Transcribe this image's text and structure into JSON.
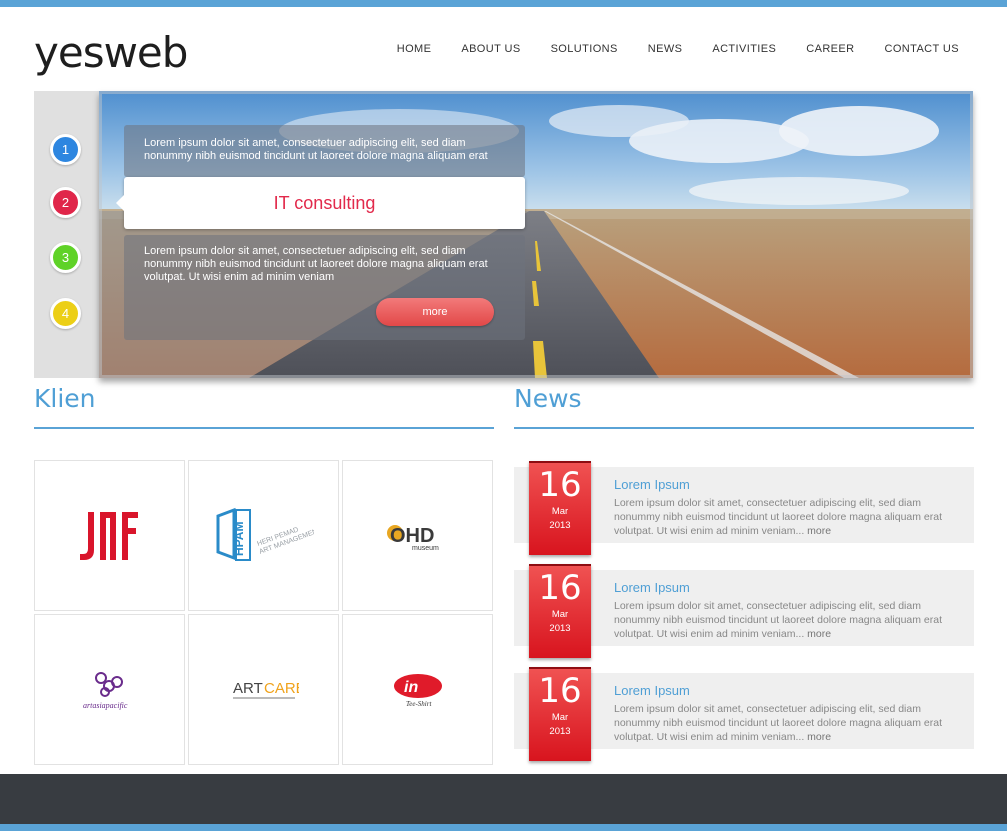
{
  "site": {
    "logo": "yesweb"
  },
  "nav": [
    "HOME",
    "ABOUT US",
    "SOLUTIONS",
    "NEWS",
    "ACTIVITIES",
    "CAREER",
    "CONTACT US"
  ],
  "slider": {
    "dots": [
      {
        "label": "1",
        "color": "#2d86e0"
      },
      {
        "label": "2",
        "color": "#e0264a"
      },
      {
        "label": "3",
        "color": "#5fd227"
      },
      {
        "label": "4",
        "color": "#eccf16"
      }
    ],
    "top_text": "Lorem ipsum dolor sit amet, consectetuer adipiscing elit, sed diam nonummy nibh euismod tincidunt ut laoreet dolore magna aliquam erat",
    "active_title": "IT consulting",
    "body_text": "Lorem ipsum dolor sit amet, consectetuer adipiscing elit, sed diam nonummy nibh euismod tincidunt ut laoreet dolore magna aliquam  erat volutpat. Ut wisi enim ad minim veniam",
    "more_label": "more"
  },
  "klien": {
    "title": "Klien",
    "logos": [
      {
        "name": "jaf-logo",
        "text": "JAF"
      },
      {
        "name": "hpam-logo",
        "text": "HPAM",
        "subtext": "HERI PEMAD ART MANAGEMENT"
      },
      {
        "name": "ohd-museum-logo",
        "text": "OHD",
        "subtext": "museum"
      },
      {
        "name": "artasiapacific-logo",
        "text": "artasiapacific"
      },
      {
        "name": "artcare-logo",
        "text": "ARTCARE"
      },
      {
        "name": "in-tshirt-logo",
        "text": "in",
        "subtext": "Tee-Shirt"
      }
    ]
  },
  "news": {
    "title": "News",
    "items": [
      {
        "day": "16",
        "month": "Mar",
        "year": "2013",
        "title": "Lorem Ipsum",
        "text": "Lorem ipsum dolor sit amet, consectetuer adipiscing elit, sed diam nonummy nibh euismod tincidunt ut laoreet dolore magna aliquam erat volutpat. Ut wisi enim ad minim veniam...",
        "more": "more"
      },
      {
        "day": "16",
        "month": "Mar",
        "year": "2013",
        "title": "Lorem Ipsum",
        "text": "Lorem ipsum dolor sit amet, consectetuer adipiscing elit, sed diam nonummy nibh euismod tincidunt ut laoreet dolore magna aliquam erat volutpat. Ut wisi enim ad minim veniam...",
        "more": "more"
      },
      {
        "day": "16",
        "month": "Mar",
        "year": "2013",
        "title": "Lorem Ipsum",
        "text": "Lorem ipsum dolor sit amet, consectetuer adipiscing elit, sed diam nonummy nibh euismod tincidunt ut laoreet dolore magna aliquam erat volutpat. Ut wisi enim ad minim veniam...",
        "more": "more"
      }
    ]
  }
}
